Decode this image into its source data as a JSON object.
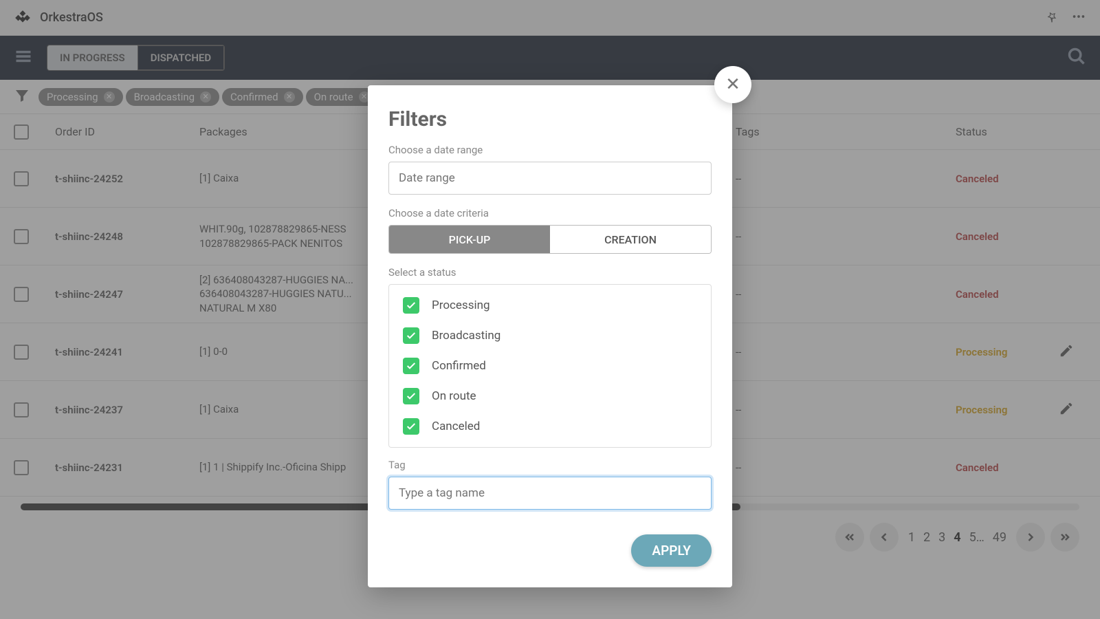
{
  "topbar": {
    "app_name": "OrkestraOS"
  },
  "nav": {
    "tab_inprogress": "IN PROGRESS",
    "tab_dispatched": "DISPATCHED"
  },
  "chips": [
    "Processing",
    "Broadcasting",
    "Confirmed",
    "On route"
  ],
  "columns": {
    "order_id": "Order ID",
    "packages": "Packages",
    "tags": "Tags",
    "status": "Status"
  },
  "rows": [
    {
      "id": "t-shiinc-24252",
      "pkg": "[1] Caixa",
      "tags": "--",
      "status": "Canceled",
      "status_class": "canceled",
      "edit": false
    },
    {
      "id": "t-shiinc-24248",
      "pkg": "WHIT.90g, 102878829865-NESS\n102878829865-PACK NENITOS",
      "tags": "--",
      "status": "Canceled",
      "status_class": "canceled",
      "edit": false
    },
    {
      "id": "t-shiinc-24247",
      "pkg": "[2] 636408043287-HUGGIES NA...\n636408043287-HUGGIES NATU...\nNATURAL M X80",
      "tags": "--",
      "status": "Canceled",
      "status_class": "canceled",
      "edit": false
    },
    {
      "id": "t-shiinc-24241",
      "pkg": "[1] 0-0",
      "tags": "--",
      "status": "Processing",
      "status_class": "processing",
      "edit": true
    },
    {
      "id": "t-shiinc-24237",
      "pkg": "[1] Caixa",
      "tags": "--",
      "status": "Processing",
      "status_class": "processing",
      "edit": true
    },
    {
      "id": "t-shiinc-24231",
      "pkg": "[1] 1 | Shippify Inc.-Oficina Shipp",
      "tags": "--",
      "status": "Canceled",
      "status_class": "canceled",
      "edit": false
    }
  ],
  "pager": {
    "pages": [
      "1",
      "2",
      "3",
      "4",
      "5…",
      "49"
    ],
    "active": "4"
  },
  "modal": {
    "title": "Filters",
    "date_range_label": "Choose a date range",
    "date_range_placeholder": "Date range",
    "criteria_label": "Choose a date criteria",
    "criteria_pickup": "PICK-UP",
    "criteria_creation": "CREATION",
    "status_label": "Select a status",
    "statuses": [
      "Processing",
      "Broadcasting",
      "Confirmed",
      "On route",
      "Canceled"
    ],
    "tag_label": "Tag",
    "tag_placeholder": "Type a tag name",
    "apply": "APPLY"
  }
}
